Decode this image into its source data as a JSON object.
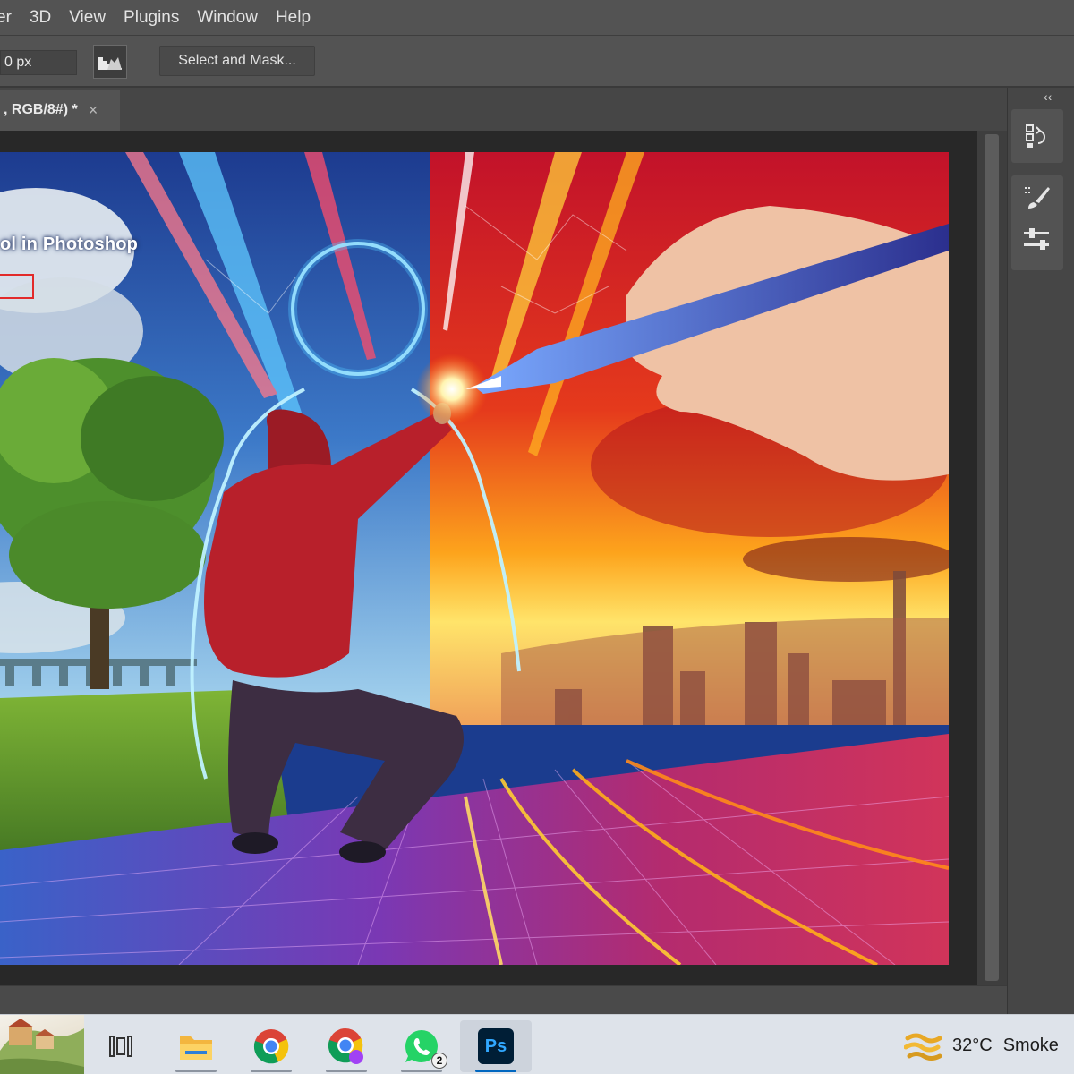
{
  "menubar": {
    "items": [
      "er",
      "3D",
      "View",
      "Plugins",
      "Window",
      "Help"
    ]
  },
  "options": {
    "feather_value": "0 px",
    "select_and_mask_label": "Select and Mask..."
  },
  "document_tab": {
    "label": ", RGB/8#) *",
    "close_glyph": "×"
  },
  "artwork": {
    "overlay_text": "ol in Photoshop"
  },
  "right_panel": {
    "collapse_glyph": "‹‹",
    "icons": [
      "history-icon",
      "brush-settings-icon",
      "adjustments-icon"
    ]
  },
  "taskbar": {
    "apps": [
      "task-view-icon",
      "file-explorer-icon",
      "chrome-icon",
      "chrome-profile-icon",
      "whatsapp-icon",
      "photoshop-icon"
    ],
    "whatsapp_badge": "2",
    "photoshop_label": "Ps",
    "weather_temp": "32°C",
    "weather_condition": "Smoke"
  },
  "colors": {
    "ui_background": "#535353",
    "canvas_background": "#282828",
    "taskbar_background": "#dee3ea",
    "photoshop_blue": "#31a8ff",
    "selection_red": "#e22a2a"
  }
}
